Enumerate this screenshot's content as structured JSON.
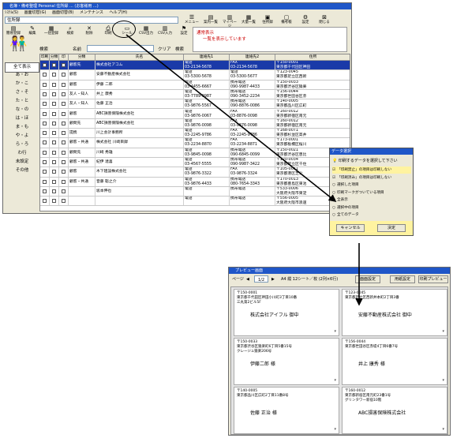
{
  "main": {
    "title": "名簿・備考整理 Personal 住所録 ... (お客様用 ...)",
    "menu": [
      "ｼｽﾃﾑ(S)",
      "画面切替(G)",
      "画面切替(B)",
      "メンテナンス",
      "ヘルプ(H)"
    ],
    "addressbook_name": "住所録",
    "toolbar_left": [
      "簡易登録",
      "編集",
      "一括登録",
      "検索",
      "削除",
      "印刷",
      "シール",
      "CSV出力",
      "CSV入力",
      "設定"
    ],
    "toolbar_right": [
      "メニュー",
      "案内一覧",
      "マイページ",
      "大量一覧",
      "住所録",
      "備考帳",
      "設定",
      "閉じる"
    ],
    "notice_title": "通常表示",
    "notice_text": "一覧を表示しています",
    "search_label": "検索",
    "name_label": "名前",
    "clear_label": "クリア",
    "search_button": "検索",
    "columns": [
      "印刷",
      "分類",
      "印",
      "分類",
      "氏名",
      "連絡先1",
      "連絡先2",
      "住所"
    ],
    "kana_index": [
      "全て表示",
      "あ・お",
      "か・こ",
      "さ・そ",
      "た・と",
      "な・の",
      "は・ほ",
      "ま・も",
      "や・よ",
      "ら・ろ",
      "わ行",
      "未設定",
      "その他"
    ],
    "rows": [
      {
        "cat": "顧客先",
        "name": "株式会社アコム",
        "c1": "電話",
        "c1n": "03-2134-5678",
        "c2": "FAX",
        "c2n": "03-2134-5678",
        "zip": "〒150-0001",
        "addr": "東京都千代田区神田"
      },
      {
        "cat": "顧客",
        "name": "安藤不動産株式会社",
        "c1": "電話",
        "c1n": "03-5300-5678",
        "c2": "電話",
        "c2n": "03-5300-5677",
        "zip": "〒123-0045",
        "addr": "東京都足立区西新"
      },
      {
        "cat": "顧客",
        "name": "伊藤 二郎",
        "c1": "電話",
        "c1n": "03-4455-6667",
        "c2": "携帯電話",
        "c2n": "090-9987-4433",
        "zip": "〒150-0033",
        "addr": "東京都渋谷区猿楽"
      },
      {
        "cat": "友人・知人",
        "name": "井上 康秀",
        "c1": "電話",
        "c1n": "03-7789-9987",
        "c2": "携帯電話",
        "c2n": "090-3452-2234",
        "zip": "〒156-0044",
        "addr": "東京都世田谷区赤"
      },
      {
        "cat": "友人・知人",
        "name": "佐藤 正治",
        "c1": "電話",
        "c1n": "03-9876-5567",
        "c2": "携帯電話",
        "c2n": "090-8876-0086",
        "zip": "〒140-0005",
        "addr": "東京都品川区広町"
      },
      {
        "cat": "顧客",
        "name": "ABC損害保険株式会社",
        "c1": "電話",
        "c1n": "03-9876-0067",
        "c2": "FAX",
        "c2n": "03-8876-0098",
        "zip": "〒160-0012",
        "addr": "東京都新宿区南元"
      },
      {
        "cat": "顧問先",
        "name": "ABC損害保険株式会社",
        "c1": "電話",
        "c1n": "03-9876-0098",
        "c2": "FAX",
        "c2n": "03-9876-0098",
        "zip": "〒160-0012",
        "addr": "東京都新宿区南元"
      },
      {
        "cat": "提携",
        "name": "川上会計事務所",
        "c1": "電話",
        "c1n": "03-2245-9786",
        "c2": "FAX",
        "c2n": "03-2245-9786",
        "zip": "〒168-0071",
        "addr": "東京都杉並区高井"
      },
      {
        "cat": "顧客・共通",
        "name": "株式会社 川崎目録",
        "c1": "電話",
        "c1n": "03-2234-8870",
        "c2": "FAX",
        "c2n": "03-2234-8871",
        "zip": "〒173-0001",
        "addr": "東京都板橋区桜川"
      },
      {
        "cat": "顧問先",
        "name": "川崎 秀雄",
        "c1": "電話",
        "c1n": "03-9845-0098",
        "c2": "携帯電話",
        "c2n": "090-6845-0099",
        "zip": "〒150-0021",
        "addr": "東京都渋谷区恵比"
      },
      {
        "cat": "顧客・共通",
        "name": "紀伊 達喜",
        "c1": "電話",
        "c1n": "03-4567-5555",
        "c2": "携帯電話",
        "c2n": "090-9987-3422",
        "zip": "〒120-0034",
        "addr": "東京都足立区千住"
      },
      {
        "cat": "顧客",
        "name": "木下建設株式会社",
        "c1": "電話",
        "c1n": "03-9876-3322",
        "c2": "FAX",
        "c2n": "03-9876-3324",
        "zip": "〒105-0011",
        "addr": "東京都港区芝公"
      },
      {
        "cat": "顧客・共通",
        "name": "音藤 聡之介",
        "c1": "電話",
        "c1n": "03-9876-4433",
        "c2": "携帯電話",
        "c2n": "080-7654-3343",
        "zip": "〒170-0013",
        "addr": "東京都豊島区東池"
      },
      {
        "cat": "",
        "name": "坂本伸也",
        "c1": "電話",
        "c1n": "",
        "c2": "携帯電話",
        "c2n": "",
        "zip": "〒533-0006",
        "addr": "大阪府大阪市東淀"
      },
      {
        "cat": "",
        "name": "",
        "c1": "電話",
        "c1n": "",
        "c2": "携帯電話",
        "c2n": "",
        "zip": "〒556-0005",
        "addr": "大阪府大阪市浪速"
      }
    ]
  },
  "dialog": {
    "title": "データ選択",
    "prompt": "印刷するデータを選択して下さい",
    "options": [
      "「印刷禁止」の項目は印刷しない",
      "「印刷済み」の項目は印刷しない",
      "選択した項目",
      "印刷マークがついている項目",
      "全表示",
      "選択中の項目",
      "全てのデータ"
    ],
    "checked": [
      true,
      true,
      false,
      false,
      true,
      false,
      false
    ],
    "cancel_label": "キャンセル",
    "ok_label": "決定"
  },
  "preview": {
    "title": "プレビュー画面",
    "page_label": "ページ",
    "page_value": "1/2",
    "paper_info": "A4 縦 12シート／枚 (2列×6行)",
    "settings_button": "面面設定",
    "print_settings_button": "用紙設定",
    "print_preview_button": "印刷プレビュー",
    "cards": [
      {
        "zip": "〒150-0001",
        "addr1": "東京都千代田区神田小川町3丁目10番",
        "addr2": "三丸第2ビル5F",
        "name": "株式会社アイフル 御中"
      },
      {
        "zip": "〒123-0045",
        "addr1": "東京都足立区西新井本町2丁目3番",
        "addr2": "",
        "name": "安藤不動産株式会社 御中"
      },
      {
        "zip": "〒150-0033",
        "addr1": "東京都渋谷区猿楽町6丁目5番15号",
        "addr2": "クレージュ猿楽206号",
        "name": "伊藤二郎 様"
      },
      {
        "zip": "〒156-0044",
        "addr1": "東京都世田谷区赤堤4丁目6番7号",
        "addr2": "",
        "name": "井上 康秀 様"
      },
      {
        "zip": "〒140-0005",
        "addr1": "東京都品川区広町2丁目11番8号",
        "addr2": "",
        "name": "佐藤 正治 様"
      },
      {
        "zip": "〒160-0012",
        "addr1": "東京都新宿区南元町23番1号",
        "addr2": "グリンタワー新宿10階",
        "name": "ABC損害保険株式会社"
      }
    ]
  },
  "colors": {
    "titlebar": "#1f56c8",
    "selected_row": "#1a3aa8",
    "dialog_yellow": "#fff3a0",
    "notice_red": "#cc0000"
  }
}
